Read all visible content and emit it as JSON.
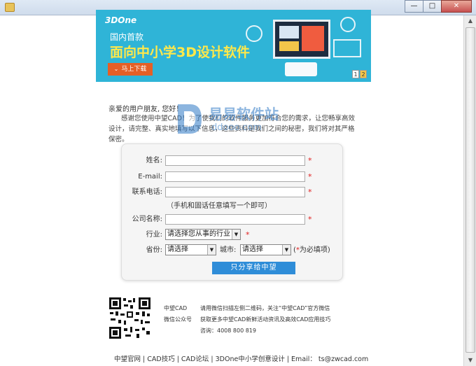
{
  "window": {
    "minimize": "—",
    "maximize": "□",
    "close": "✕"
  },
  "banner": {
    "logo": "3DOne",
    "subtitle": "国内首款",
    "title": "面向中小学3D设计软件",
    "download_label": "马上下载",
    "pages": [
      "1",
      "2"
    ]
  },
  "intro": {
    "greeting": "亲爱的用户朋友, 您好！",
    "body": "感谢您使用中望CAD！为了使我们的软件服务更加符合您的需求，让您畅享高效设计，请完整、真实地填写以下信息，这些资料是我们之间的秘密，我们将对其严格保密。"
  },
  "watermark": {
    "text": "易易软件站",
    "url": "ddooo.com"
  },
  "form": {
    "name_label": "姓名:",
    "email_label": "E-mail:",
    "phone_label": "联系电话:",
    "phone_hint": "（手机和固话任意填写一个即可）",
    "company_label": "公司名称:",
    "industry_label": "行业:",
    "industry_value": "请选择您从事的行业",
    "province_label": "省份:",
    "province_value": "请选择",
    "city_label": "城市:",
    "city_value": "请选择",
    "required_star": "*",
    "required_note_prefix": "(",
    "required_note_suffix": "为必填项)",
    "submit_label": "只分享给中望"
  },
  "footer": {
    "qr_name": "中望CAD",
    "qr_sub": "微信公众号",
    "desc_line1": "请用微信扫描左侧二维码，关注“中望CAD”官方微信",
    "desc_line2": "获取更多中望CAD新鲜活动资讯及高效CAD应用技巧",
    "desc_line3": "咨询：4008 800 819",
    "links": "中望官网 | CAD技巧 | CAD论坛 | 3DOne中小学创意设计 | Email： ts@zwcad.com"
  },
  "colors": {
    "banner_bg": "#2fb4d7",
    "banner_title": "#ffe84a",
    "download_button": "#e55f26",
    "submit_button": "#2f8dd8",
    "required": "#e02020"
  }
}
